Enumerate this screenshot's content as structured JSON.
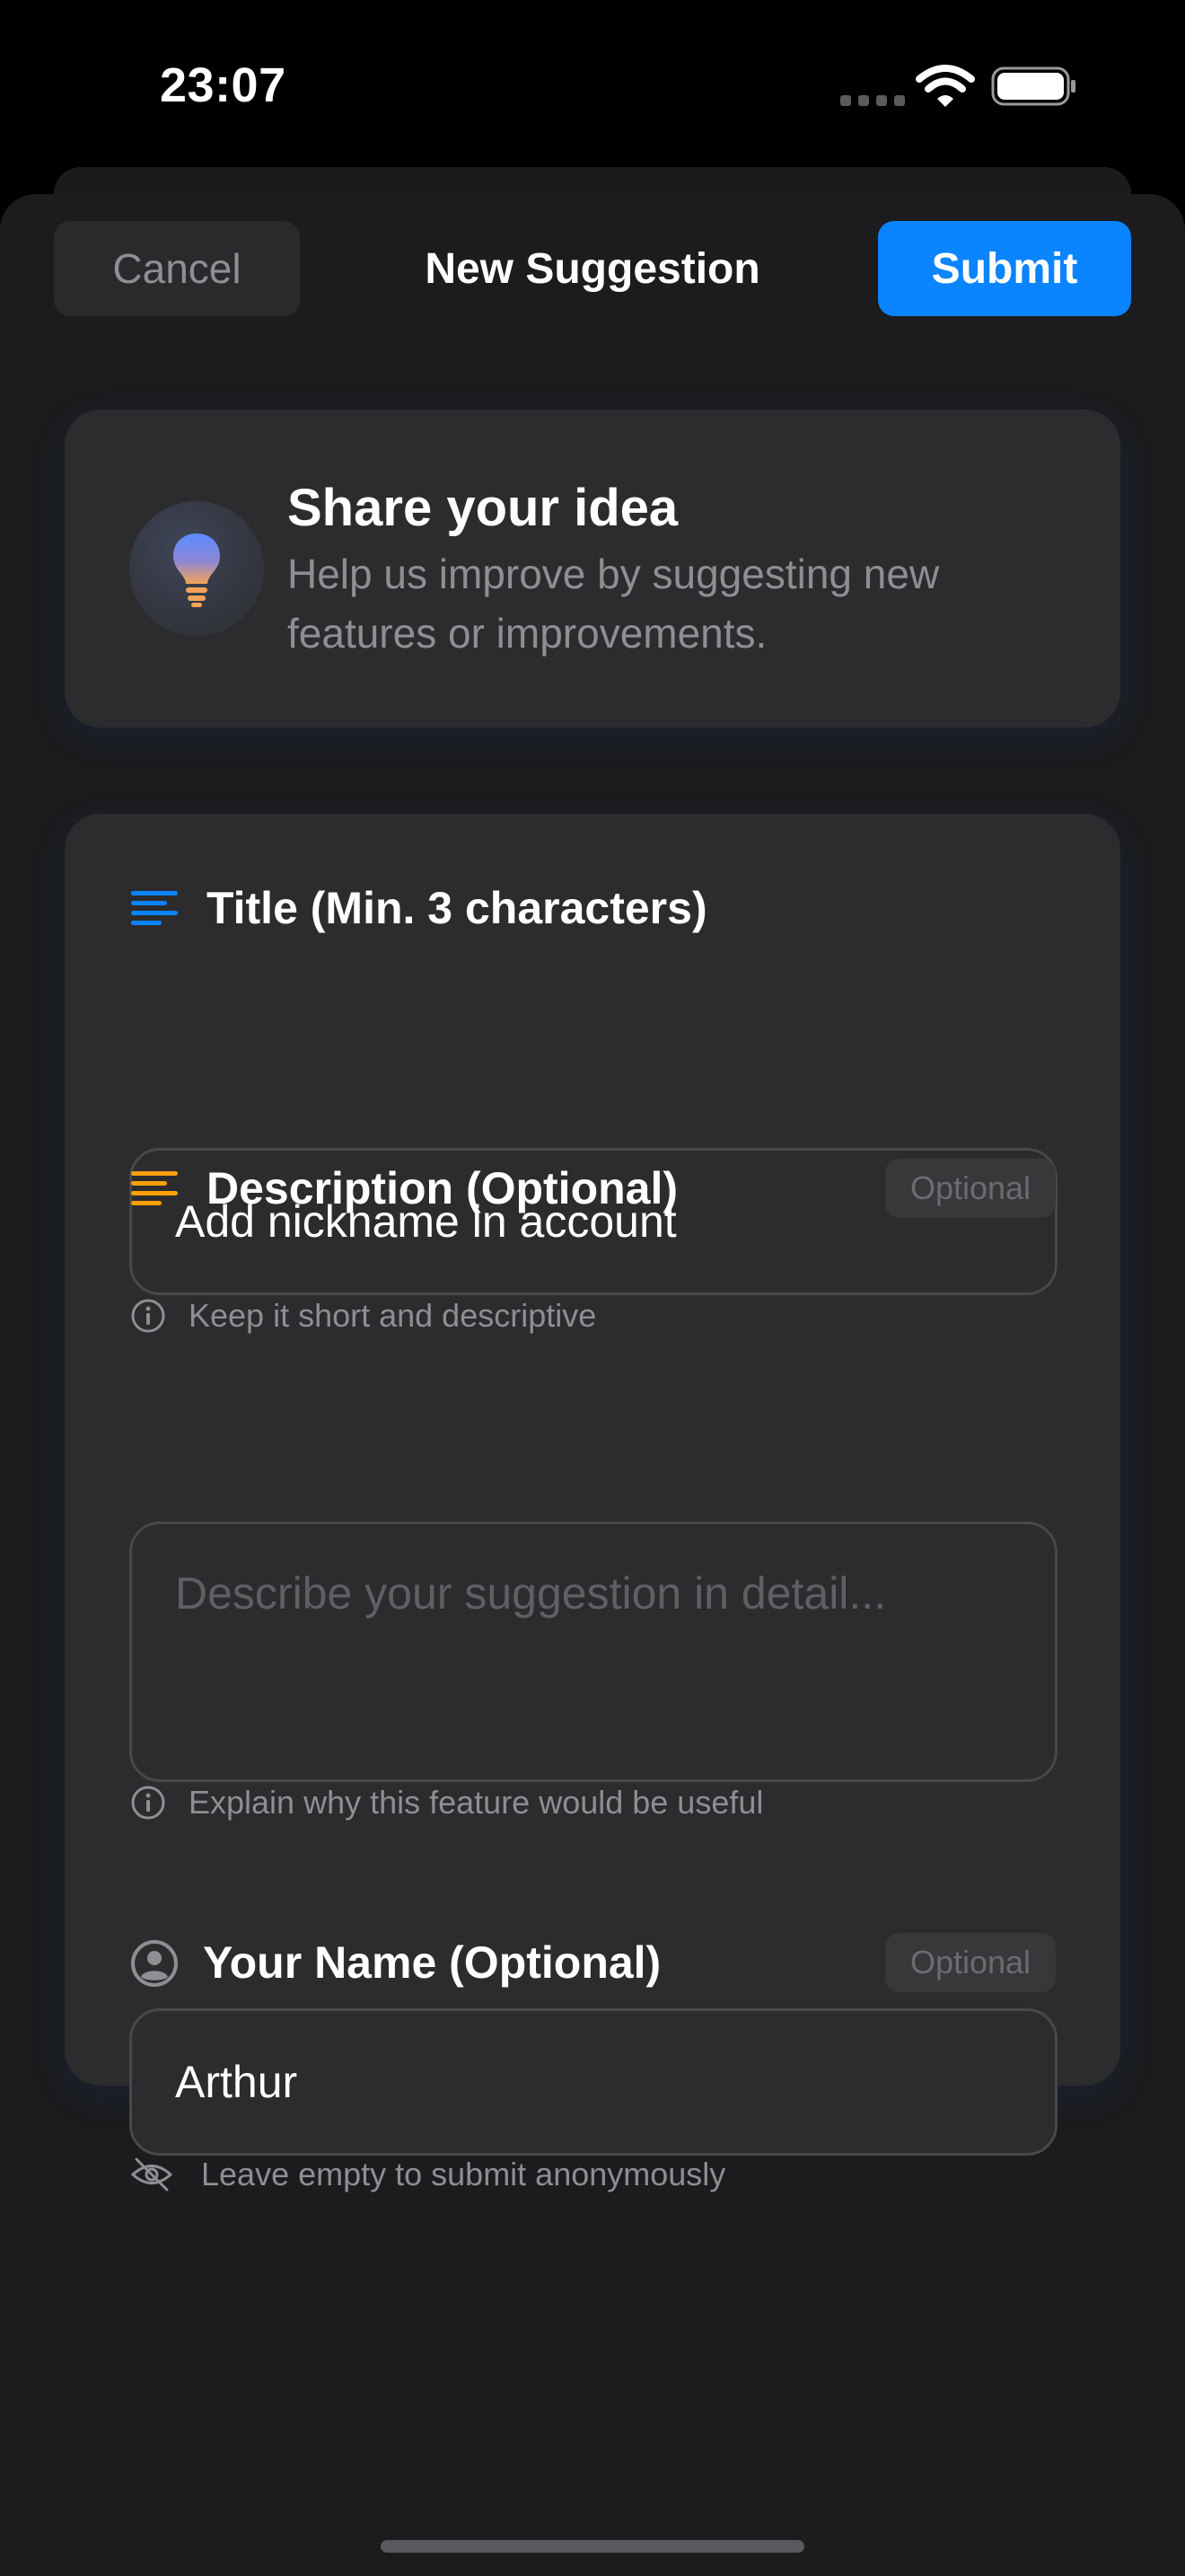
{
  "status_bar": {
    "time": "23:07"
  },
  "nav": {
    "cancel_label": "Cancel",
    "title": "New Suggestion",
    "submit_label": "Submit"
  },
  "intro": {
    "title": "Share your idea",
    "description": "Help us improve by suggesting new features or improvements."
  },
  "form": {
    "title_field": {
      "label": "Title (Min. 3 characters)",
      "value": "Add nickname in account",
      "hint": "Keep it short and descriptive"
    },
    "description_field": {
      "label": "Description (Optional)",
      "badge": "Optional",
      "placeholder": "Describe your suggestion in detail...",
      "value": "",
      "hint": "Explain why this feature would be useful"
    },
    "name_field": {
      "label": "Your Name (Optional)",
      "badge": "Optional",
      "value": "Arthur",
      "hint": "Leave empty to submit anonymously"
    }
  },
  "icons": {
    "bulb": "lightbulb-icon",
    "title": "text-align-left-icon",
    "description": "text-align-left-icon",
    "name": "person-circle-icon",
    "hint_info": "info-circle-icon",
    "hint_anon": "eye-slash-icon"
  },
  "colors": {
    "accent": "#0a84ff",
    "description_icon": "#ff9f0a",
    "background": "#1c1c1e",
    "card": "#2c2c2e"
  }
}
